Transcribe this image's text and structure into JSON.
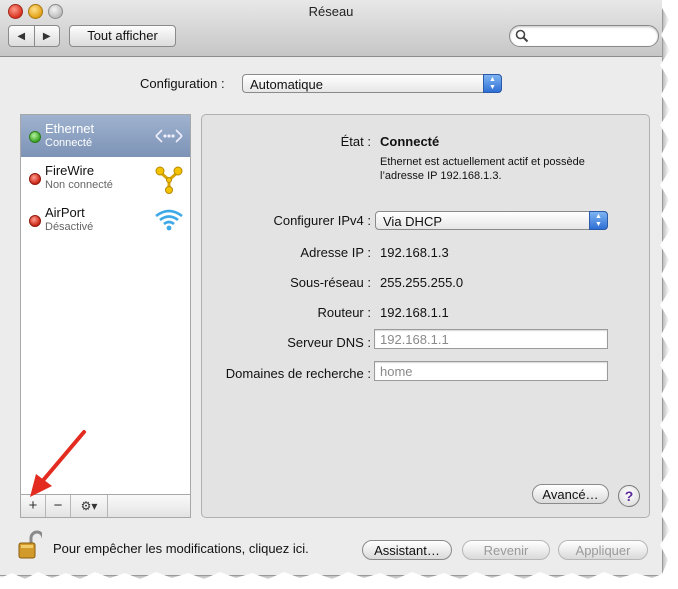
{
  "window": {
    "title": "Réseau"
  },
  "toolbar": {
    "back_icon": "◀",
    "forward_icon": "▶",
    "show_all_label": "Tout afficher",
    "search_value": "",
    "search_placeholder": ""
  },
  "configuration": {
    "label": "Configuration :",
    "value": "Automatique"
  },
  "services": [
    {
      "name": "Ethernet",
      "status": "Connecté",
      "status_color": "#3aa424",
      "icon": "ethernet-icon",
      "selected": true
    },
    {
      "name": "FireWire",
      "status": "Non connecté",
      "status_color": "#cc2414",
      "icon": "firewire-icon",
      "selected": false
    },
    {
      "name": "AirPort",
      "status": "Désactivé",
      "status_color": "#cc2414",
      "icon": "airport-icon",
      "selected": false
    }
  ],
  "sidebar_toolbar": {
    "add": "+",
    "remove": "−",
    "action": "⚙▾"
  },
  "details": {
    "state_label": "État :",
    "state_value": "Connecté",
    "state_note": "Ethernet est actuellement actif et possède l’adresse IP 192.168.1.3.",
    "ipv4_label": "Configurer IPv4 :",
    "ipv4_value": "Via DHCP",
    "ip_label": "Adresse IP :",
    "ip_value": "192.168.1.3",
    "subnet_label": "Sous-réseau :",
    "subnet_value": "255.255.255.0",
    "router_label": "Routeur :",
    "router_value": "192.168.1.1",
    "dns_label": "Serveur DNS :",
    "dns_value": "",
    "dns_placeholder": "192.168.1.1",
    "search_domains_label": "Domaines de recherche :",
    "search_domains_value": "",
    "search_domains_placeholder": "home"
  },
  "buttons": {
    "advanced": "Avancé…",
    "help": "?",
    "assistant": "Assistant…",
    "revert": "Revenir",
    "apply": "Appliquer"
  },
  "lock": {
    "text": "Pour empêcher les modifications, cliquez ici."
  },
  "colors": {
    "selection": "#8aa0c0",
    "arrow": "#e32b1f",
    "popup_blue": "#2f6fd6"
  }
}
